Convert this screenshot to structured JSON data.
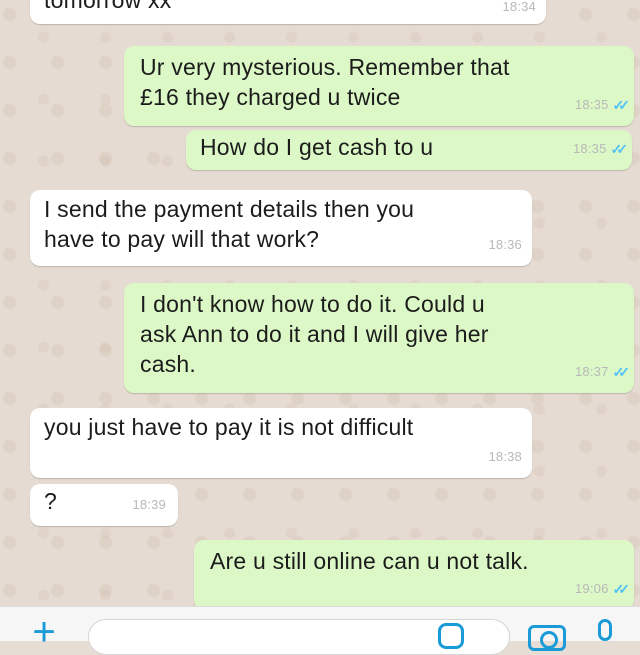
{
  "chat": {
    "messages": [
      {
        "direction": "in",
        "text": "tomorrow xx",
        "time": "18:34",
        "ticks": ""
      },
      {
        "direction": "out",
        "text": "Ur very mysterious. Remember that\n£16 they charged u twice",
        "time": "18:35",
        "ticks": "✓✓"
      },
      {
        "direction": "out",
        "text": "How do I get cash to u",
        "time": "18:35",
        "ticks": "✓✓"
      },
      {
        "direction": "in",
        "text": "I send the payment details then you\nhave to pay will that work?",
        "time": "18:36",
        "ticks": ""
      },
      {
        "direction": "out",
        "text": "I don't know how to do it. Could u\nask Ann to do it and I will give her\ncash.",
        "time": "18:37",
        "ticks": "✓✓"
      },
      {
        "direction": "in",
        "text": "you just have to pay it is not difficult",
        "time": "18:38",
        "ticks": ""
      },
      {
        "direction": "in",
        "text": "?",
        "time": "18:39",
        "ticks": ""
      },
      {
        "direction": "out",
        "text": "Are u still online can u not talk.",
        "time": "19:06",
        "ticks": "✓✓"
      }
    ]
  },
  "input_bar": {
    "icons": [
      "plus-icon",
      "sticker-icon",
      "camera-icon",
      "microphone-icon"
    ]
  },
  "colors": {
    "outgoing_bubble": "#dcf8c6",
    "incoming_bubble": "#ffffff",
    "read_ticks": "#4fc3f7",
    "accent": "#1a9bd8",
    "wallpaper": "#e5dbd2"
  }
}
